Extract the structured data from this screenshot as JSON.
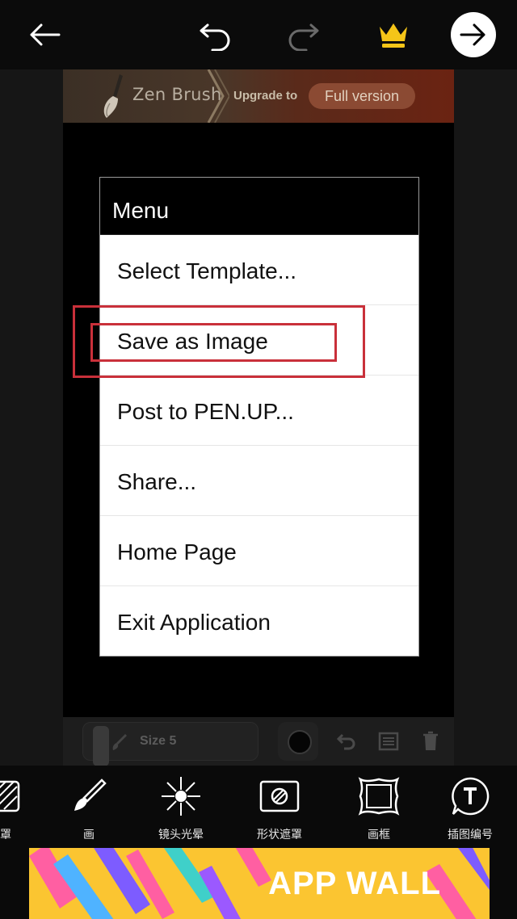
{
  "topbar": {
    "back_icon": "arrow-left-icon",
    "undo_icon": "undo-icon",
    "redo_icon": "redo-icon",
    "crown_icon": "crown-icon",
    "next_icon": "arrow-right-circle-icon",
    "crown_color": "#f5c518"
  },
  "banner": {
    "app_name": "Zen Brush",
    "upgrade_text": "Upgrade to",
    "full_version": "Full version"
  },
  "menu": {
    "title": "Menu",
    "items": [
      {
        "label": "Select Template..."
      },
      {
        "label": "Save as Image"
      },
      {
        "label": "Post to PEN.UP..."
      },
      {
        "label": "Share..."
      },
      {
        "label": "Home Page"
      },
      {
        "label": "Exit Application"
      }
    ],
    "highlighted_item": "Save as Image",
    "highlight_color": "#c9303a"
  },
  "appbar": {
    "size_label": "Size 5"
  },
  "tools": [
    {
      "label": "罩",
      "icon": "mask-icon"
    },
    {
      "label": "画",
      "icon": "brush-icon"
    },
    {
      "label": "镜头光晕",
      "icon": "lens-flare-icon"
    },
    {
      "label": "形状遮罩",
      "icon": "shape-mask-icon"
    },
    {
      "label": "画框",
      "icon": "frame-icon"
    },
    {
      "label": "插图编号",
      "icon": "text-badge-icon"
    }
  ],
  "ad": {
    "text": "APP WALL",
    "background": "#fbc531"
  }
}
